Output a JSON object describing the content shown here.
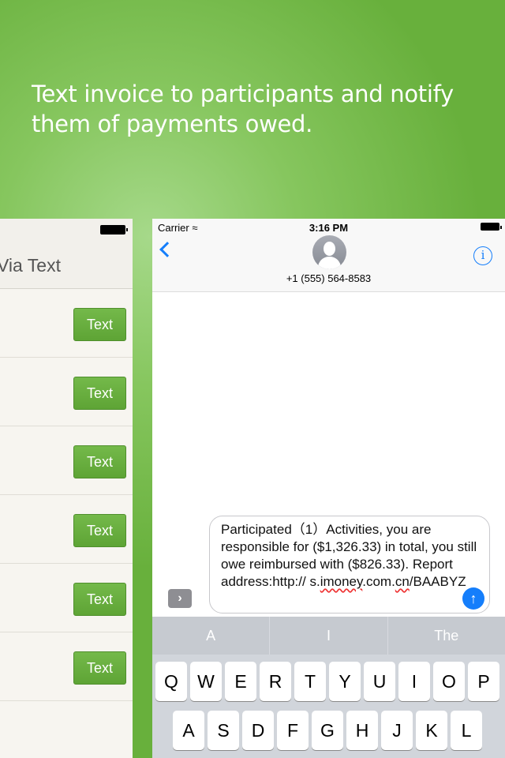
{
  "headline": "Text invoice to participants and notify them of payments owed.",
  "left_panel": {
    "title": "Via Text",
    "buttons": [
      "Text",
      "Text",
      "Text",
      "Text",
      "Text",
      "Text"
    ]
  },
  "status_bar": {
    "carrier": "Carrier",
    "time": "3:16 PM"
  },
  "contact": {
    "phone": "+1 (555) 564-8583"
  },
  "message": {
    "line1": "Participated（1）Activities, you are responsible for ($1,326.33) in total, you still owe reimbursed with ($826.33). Report address:http://",
    "url_a": "s.",
    "url_b": "imoney",
    "url_c": ".com.",
    "url_d": "cn",
    "url_e": "/BAABYZ"
  },
  "suggestions": [
    "A",
    "I",
    "The"
  ],
  "keys_row1": [
    "Q",
    "W",
    "E",
    "R",
    "T",
    "Y",
    "U",
    "I",
    "O",
    "P"
  ],
  "keys_row2": [
    "A",
    "S",
    "D",
    "F",
    "G",
    "H",
    "J",
    "K",
    "L"
  ],
  "icons": {
    "back": "chevron-left-icon",
    "info": "info-icon",
    "send": "arrow-up-icon",
    "expand": "chevron-right-icon",
    "wifi": "wifi-icon",
    "battery": "battery-icon",
    "avatar": "person-icon"
  },
  "colors": {
    "accent": "#157efb",
    "green": "#6db33f"
  }
}
